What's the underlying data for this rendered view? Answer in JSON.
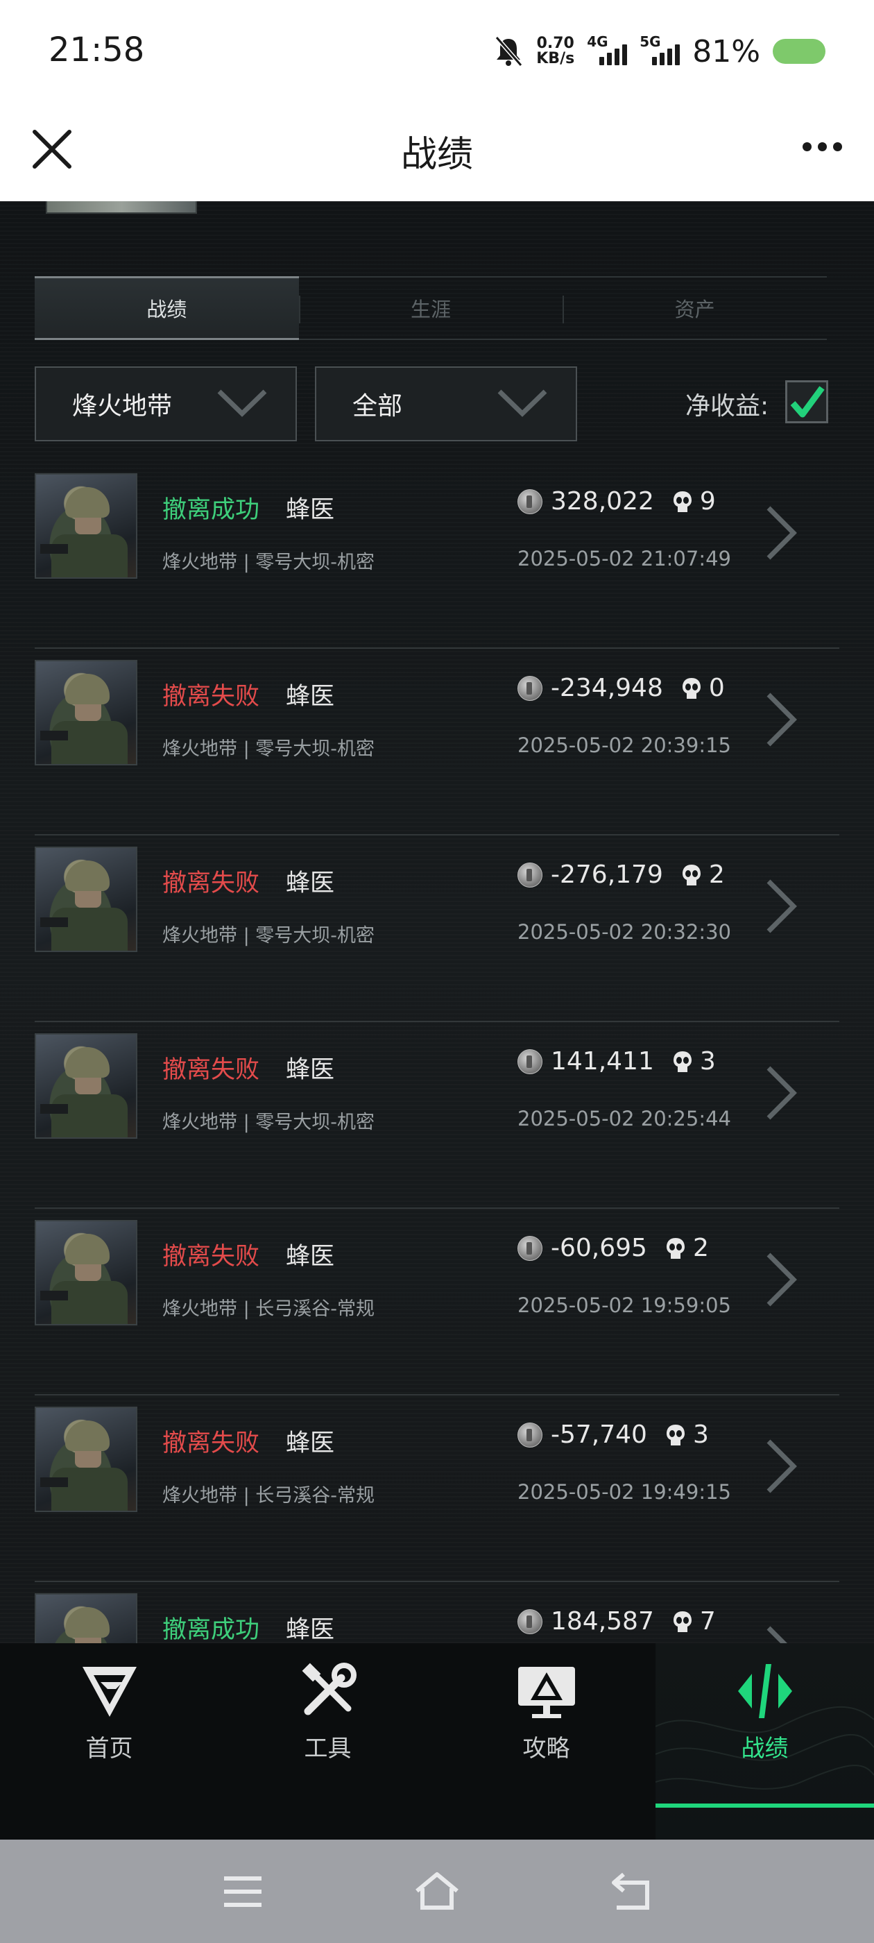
{
  "status_bar": {
    "time": "21:58",
    "net_speed_value": "0.70",
    "net_speed_unit": "KB/s",
    "signal1_label": "4G",
    "signal2_label": "5G",
    "battery_percent": "81%",
    "battery_level": 0.81
  },
  "title_bar": {
    "title": "战绩",
    "close_icon": "close-icon",
    "more_icon": "more-icon"
  },
  "tabs": [
    {
      "label": "战绩",
      "active": true
    },
    {
      "label": "生涯",
      "active": false
    },
    {
      "label": "资产",
      "active": false
    }
  ],
  "filters": {
    "mode": "烽火地带",
    "scope": "全部",
    "net_income_label": "净收益:",
    "net_income_checked": true
  },
  "records": [
    {
      "status": "撤离成功",
      "result": "success",
      "operator": "蜂医",
      "map": "烽火地带 | 零号大坝-机密",
      "value": "328,022",
      "kills": "9",
      "time": "2025-05-02 21:07:49"
    },
    {
      "status": "撤离失败",
      "result": "fail",
      "operator": "蜂医",
      "map": "烽火地带 | 零号大坝-机密",
      "value": "-234,948",
      "kills": "0",
      "time": "2025-05-02 20:39:15"
    },
    {
      "status": "撤离失败",
      "result": "fail",
      "operator": "蜂医",
      "map": "烽火地带 | 零号大坝-机密",
      "value": "-276,179",
      "kills": "2",
      "time": "2025-05-02 20:32:30"
    },
    {
      "status": "撤离失败",
      "result": "fail",
      "operator": "蜂医",
      "map": "烽火地带 | 零号大坝-机密",
      "value": "141,411",
      "kills": "3",
      "time": "2025-05-02 20:25:44"
    },
    {
      "status": "撤离失败",
      "result": "fail",
      "operator": "蜂医",
      "map": "烽火地带 | 长弓溪谷-常规",
      "value": "-60,695",
      "kills": "2",
      "time": "2025-05-02 19:59:05"
    },
    {
      "status": "撤离失败",
      "result": "fail",
      "operator": "蜂医",
      "map": "烽火地带 | 长弓溪谷-常规",
      "value": "-57,740",
      "kills": "3",
      "time": "2025-05-02 19:49:15"
    },
    {
      "status": "撤离成功",
      "result": "success",
      "operator": "蜂医",
      "map": "",
      "value": "184,587",
      "kills": "7",
      "time": ""
    }
  ],
  "bottom_nav": [
    {
      "label": "首页",
      "icon": "home-logo-icon",
      "active": false
    },
    {
      "label": "工具",
      "icon": "tools-icon",
      "active": false
    },
    {
      "label": "攻略",
      "icon": "guide-monitor-icon",
      "active": false
    },
    {
      "label": "战绩",
      "icon": "records-icon",
      "active": true
    }
  ],
  "colors": {
    "success": "#3ecf7b",
    "fail": "#e34b4b",
    "accent": "#1fd67c",
    "background": "#15181a"
  }
}
